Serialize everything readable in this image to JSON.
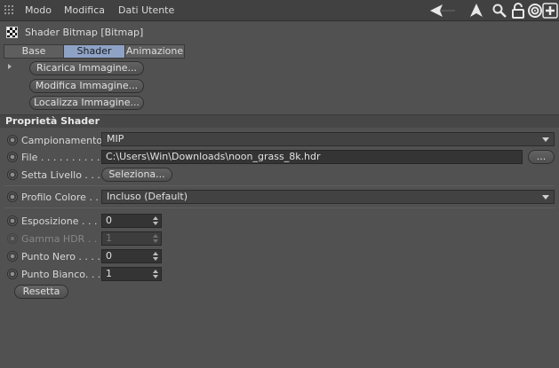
{
  "menubar": {
    "items": [
      "Modo",
      "Modifica",
      "Dati Utente"
    ],
    "icons": [
      "back-arrow-icon",
      "pointer-icon",
      "search-icon",
      "lock-icon",
      "target-icon",
      "new-panel-icon"
    ]
  },
  "title": "Shader Bitmap [Bitmap]",
  "tabs": [
    "Base",
    "Shader",
    "Animazione"
  ],
  "active_tab": "Shader",
  "buttons": {
    "reload": "Ricarica Immagine...",
    "edit": "Modifica Immagine...",
    "locate": "Localizza Immagine..."
  },
  "section_title": "Proprietà Shader",
  "props": {
    "sampling_label": "Campionamento",
    "sampling_value": "MIP",
    "file_label": "File . . . . . . . . . . .",
    "file_value": "C:\\Users\\Win\\Downloads\\noon_grass_8k.hdr",
    "file_browse": "...",
    "layer_label": "Setta Livello . . . .",
    "layer_button": "Seleziona...",
    "profile_label": "Profilo Colore . .",
    "profile_value": "Incluso (Default)",
    "exposure_label": "Esposizione . . . .",
    "exposure_value": "0",
    "gamma_label": "Gamma HDR . . . .",
    "gamma_value": "1",
    "black_label": "Punto Nero . . . .",
    "black_value": "0",
    "white_label": "Punto Bianco. . . .",
    "white_value": "1",
    "reset": "Resetta"
  },
  "colors": {
    "background": "#515151",
    "active_tab": "#8ea2c6"
  }
}
